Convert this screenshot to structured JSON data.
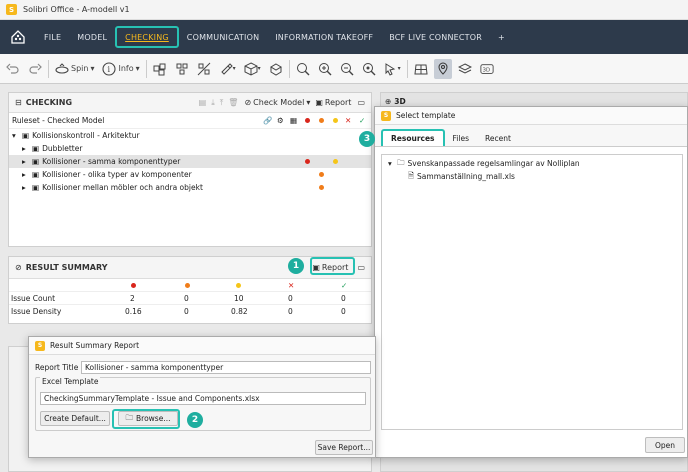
{
  "window": {
    "title": "Solibri Office - A-modell v1"
  },
  "menu": {
    "items": [
      "FILE",
      "MODEL",
      "CHECKING",
      "COMMUNICATION",
      "INFORMATION TAKEOFF",
      "BCF LIVE CONNECTOR",
      "+"
    ]
  },
  "toolbar": {
    "spin_label": "Spin",
    "info_label": "Info"
  },
  "checking": {
    "title": "CHECKING",
    "check_model_label": "Check Model",
    "report_label": "Report",
    "ruleset_label": "Ruleset - Checked Model",
    "tree": [
      {
        "label": "Kollisionskontroll - Arkitektur",
        "level": 0,
        "expand": "▾"
      },
      {
        "label": "Dubbletter",
        "level": 1,
        "expand": "▸"
      },
      {
        "label": "Kollisioner - samma komponenttyper",
        "level": 1,
        "expand": "▸"
      },
      {
        "label": "Kollisioner - olika typer av komponenter",
        "level": 1,
        "expand": "▸"
      },
      {
        "label": "Kollisioner mellan möbler och andra objekt",
        "level": 1,
        "expand": "▸"
      }
    ]
  },
  "result_summary": {
    "title": "RESULT SUMMARY",
    "report_label": "Report",
    "rows": [
      {
        "label": "Issue Count",
        "values": [
          "2",
          "0",
          "10",
          "0",
          "0"
        ]
      },
      {
        "label": "Issue Density",
        "values": [
          "0.16",
          "0",
          "0.82",
          "0",
          "0"
        ]
      }
    ]
  },
  "view3d": {
    "title": "3D"
  },
  "report_dialog": {
    "title": "Result Summary Report",
    "report_title_label": "Report Title",
    "report_title_value": "Kollisioner - samma komponenttyper",
    "excel_template_label": "Excel Template",
    "excel_template_value": "CheckingSummaryTemplate - Issue and Components.xlsx",
    "create_default_label": "Create Default...",
    "browse_label": "Browse...",
    "save_report_label": "Save Report..."
  },
  "select_dialog": {
    "title": "Select template",
    "tabs": [
      "Resources",
      "Files",
      "Recent"
    ],
    "folder": "Svenskanpassade regelsamlingar av Nolliplan",
    "file": "Sammanställning_mall.xls",
    "open_label": "Open"
  },
  "callouts": [
    "1",
    "2",
    "3"
  ],
  "colors": {
    "accent": "#27c1b3",
    "menubar": "#2d3a4b",
    "active_menu": "#f6b81c",
    "red": "#d9261c",
    "orange": "#f07d1a",
    "yellow": "#f5c518",
    "green": "#1f9e5a"
  },
  "icons": [
    "home-icon",
    "undo-icon",
    "redo-icon",
    "spin-icon",
    "info-icon",
    "folder-icon",
    "file-icon",
    "close-x-icon",
    "check-icon"
  ]
}
